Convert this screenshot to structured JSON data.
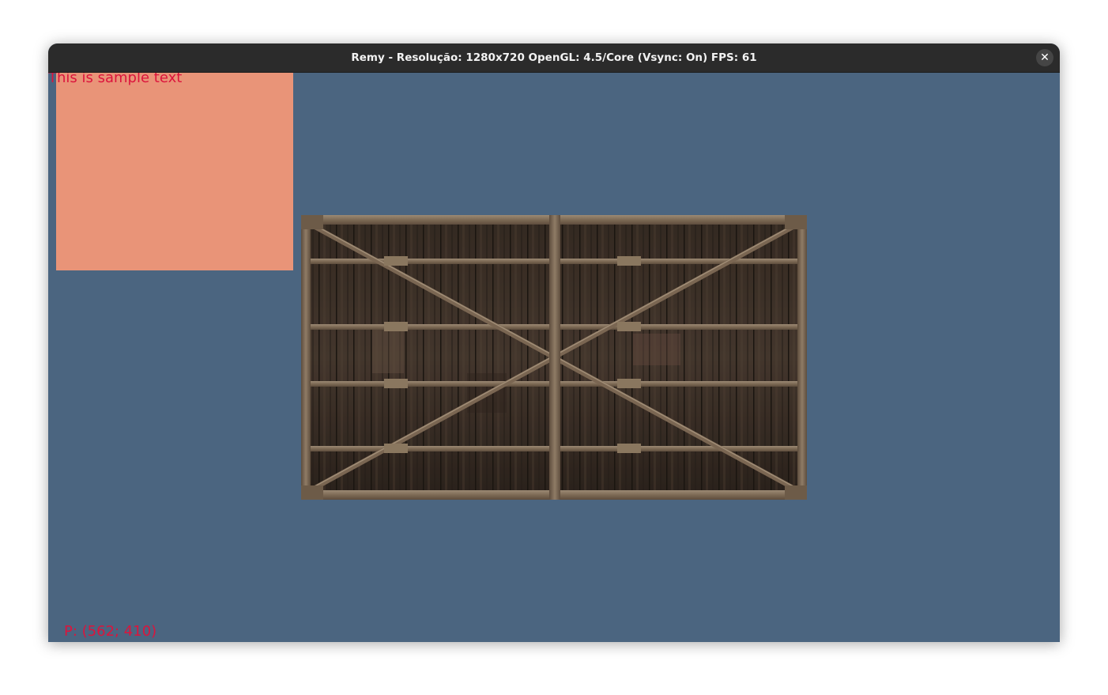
{
  "window": {
    "title": "Remy - Resolução: 1280x720 OpenGL: 4.5/Core (Vsync: On) FPS: 61",
    "close_icon": "close-icon"
  },
  "viewport": {
    "background_color": "#4b6580",
    "sample_text": "This is sample text",
    "position_readout": "P: (562; 410)",
    "text_color": "#dc143c",
    "quad_color": "#e99478",
    "sprite": "wooden-crate-texture"
  }
}
